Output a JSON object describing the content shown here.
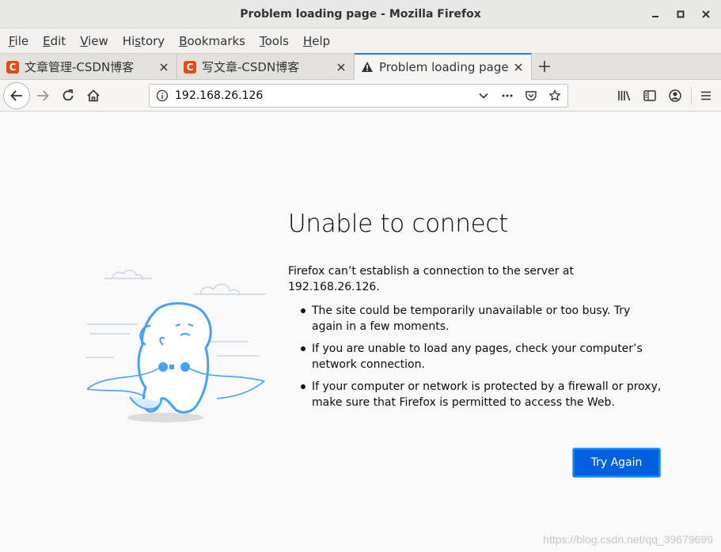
{
  "window": {
    "title": "Problem loading page - Mozilla Firefox",
    "controls": [
      "minimize",
      "maximize",
      "close"
    ]
  },
  "menubar": {
    "items": [
      {
        "label": "File",
        "accel": "F"
      },
      {
        "label": "Edit",
        "accel": "E"
      },
      {
        "label": "View",
        "accel": "V"
      },
      {
        "label": "History",
        "accel": "s"
      },
      {
        "label": "Bookmarks",
        "accel": "B"
      },
      {
        "label": "Tools",
        "accel": "T"
      },
      {
        "label": "Help",
        "accel": "H"
      }
    ]
  },
  "tabs": [
    {
      "label": "文章管理-CSDN博客",
      "favicon": "C",
      "active": false
    },
    {
      "label": "写文章-CSDN博客",
      "favicon": "C",
      "active": false
    },
    {
      "label": "Problem loading page",
      "favicon": "warning-icon",
      "active": true
    }
  ],
  "navbar": {
    "url": "192.168.26.126"
  },
  "error_page": {
    "title": "Unable to connect",
    "description": "Firefox can’t establish a connection to the server at 192.168.26.126.",
    "bullets": [
      "The site could be temporarily unavailable or too busy. Try again in a few moments.",
      "If you are unable to load any pages, check your computer’s network connection.",
      "If your computer or network is protected by a firewall or proxy, make sure that Firefox is permitted to access the Web."
    ],
    "try_again_label": "Try Again"
  },
  "watermark": "https://blog.csdn.net/qq_39679699",
  "colors": {
    "accent": "#0a84ff",
    "button": "#0060df",
    "csdn": "#e64a19",
    "illustration": "#45a1ff"
  }
}
